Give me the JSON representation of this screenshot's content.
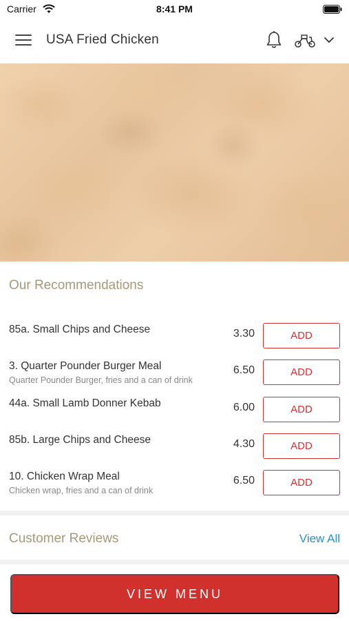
{
  "status_bar": {
    "carrier": "Carrier",
    "time": "8:41 PM"
  },
  "header": {
    "title": "USA Fried Chicken",
    "icons": [
      "menu-icon",
      "bell-icon",
      "scooter-icon",
      "chevron-down-icon"
    ]
  },
  "recommendations": {
    "title": "Our Recommendations",
    "items": [
      {
        "name": "85a. Small Chips and Cheese",
        "description": "",
        "price": "3.30",
        "button": "ADD"
      },
      {
        "name": "3. Quarter Pounder Burger Meal",
        "description": "Quarter Pounder Burger, fries and a can of drink",
        "price": "6.50",
        "button": "ADD"
      },
      {
        "name": "44a. Small Lamb Donner Kebab",
        "description": "",
        "price": "6.00",
        "button": "ADD"
      },
      {
        "name": "85b. Large Chips and Cheese",
        "description": "",
        "price": "4.30",
        "button": "ADD"
      },
      {
        "name": "10. Chicken Wrap Meal",
        "description": "Chicken wrap, fries and a can of drink",
        "price": "6.50",
        "button": "ADD"
      }
    ]
  },
  "reviews": {
    "title": "Customer Reviews",
    "view_all": "View All"
  },
  "bottom": {
    "view_menu": "VIEW MENU"
  },
  "colors": {
    "accent_red": "#d0312d",
    "section_title": "#a8987a",
    "link_blue": "#2b8fc9"
  }
}
